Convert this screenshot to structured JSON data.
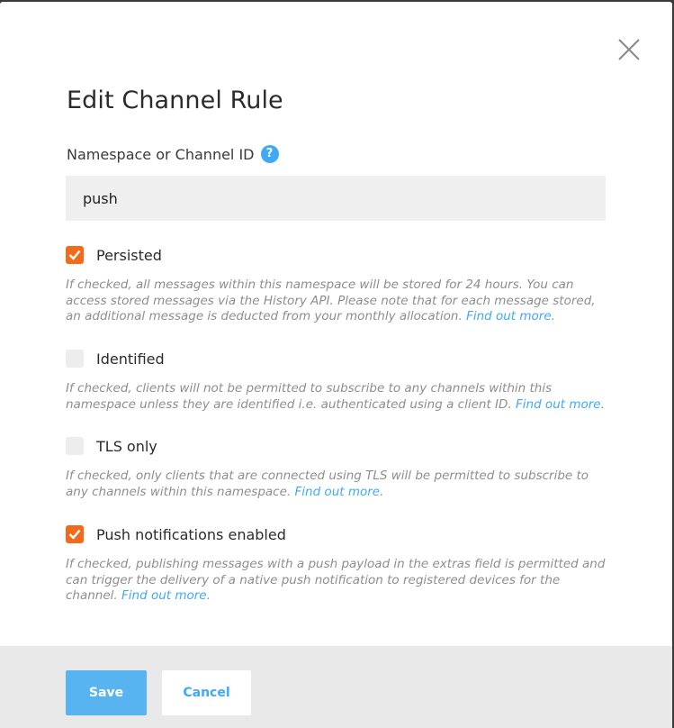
{
  "dialog": {
    "title": "Edit Channel Rule",
    "close_icon": "close-icon"
  },
  "namespace": {
    "label": "Namespace or Channel ID",
    "help_icon_glyph": "?",
    "value": "push",
    "placeholder": ""
  },
  "options": [
    {
      "label": "Persisted",
      "checked": true,
      "description": "If checked, all messages within this namespace will be stored for 24 hours. You can access stored messages via the History API. Please note that for each message stored, an additional message is deducted from your monthly allocation.",
      "link": "Find out more",
      "suffix": "."
    },
    {
      "label": "Identified",
      "checked": false,
      "description": "If checked, clients will not be permitted to subscribe to any channels within this namespace unless they are identified i.e. authenticated using a client ID.",
      "link": "Find out more",
      "suffix": "."
    },
    {
      "label": "TLS only",
      "checked": false,
      "description": "If checked, only clients that are connected using TLS will be permitted to subscribe to any channels within this namespace.",
      "link": "Find out more",
      "suffix": "."
    },
    {
      "label": "Push notifications enabled",
      "checked": true,
      "description": "If checked, publishing messages with a push payload in the extras field is permitted and can trigger the delivery of a native push notification to registered devices for the channel.",
      "link": "Find out more",
      "suffix": "."
    }
  ],
  "footer": {
    "save_label": "Save",
    "cancel_label": "Cancel"
  },
  "colors": {
    "accent": "#3fa9f5",
    "checkbox_checked": "#f26b1d",
    "save_button": "#58b4f0"
  }
}
